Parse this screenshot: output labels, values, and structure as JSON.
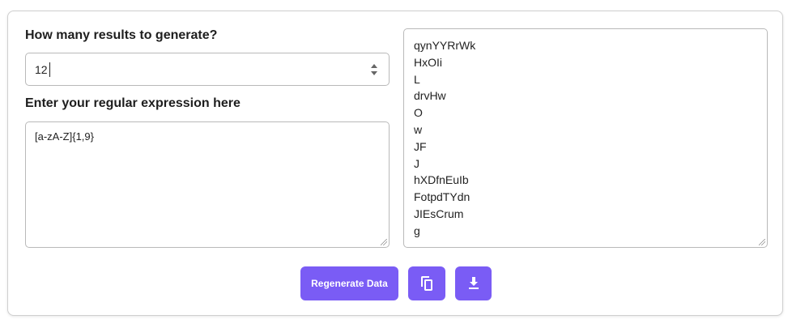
{
  "count": {
    "label": "How many results to generate?",
    "value": "12"
  },
  "regex": {
    "label": "Enter your regular expression here",
    "value": "[a-zA-Z]{1,9}"
  },
  "results": [
    "qynYYRrWk",
    "HxOIi",
    "L",
    "drvHw",
    "O",
    "w",
    "JF",
    "J",
    "hXDfnEuIb",
    "FotpdTYdn",
    "JIEsCrum",
    "g"
  ],
  "actions": {
    "regenerate_label": "Regenerate Data",
    "copy_icon": "copy-icon",
    "download_icon": "download-icon"
  },
  "colors": {
    "accent": "#7a5cf5"
  }
}
